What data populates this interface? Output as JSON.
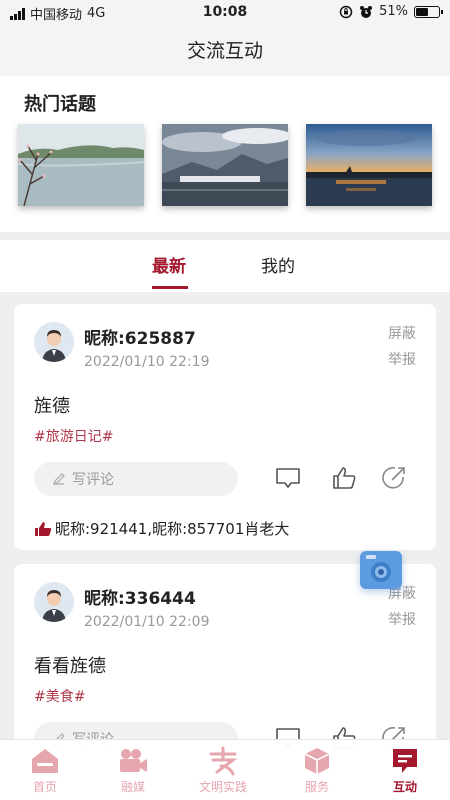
{
  "status": {
    "carrier": "中国移动",
    "network": "4G",
    "time": "10:08",
    "battery": "51%",
    "battery_level": 0.51
  },
  "header": {
    "title": "交流互动"
  },
  "hot": {
    "title": "热门话题",
    "images": [
      {
        "icon": "lake-photo"
      },
      {
        "icon": "mountain-town-photo"
      },
      {
        "icon": "sunset-lake-photo"
      }
    ]
  },
  "tabs": [
    {
      "label": "最新",
      "active": true
    },
    {
      "label": "我的",
      "active": false
    }
  ],
  "posts": [
    {
      "nickname": "昵称:625887",
      "time": "2022/01/10 22:19",
      "block": "屏蔽",
      "report": "举报",
      "content": "旌德",
      "tag": "#旅游日记#",
      "comment_placeholder": "写评论",
      "likes": "昵称:921441,昵称:857701肖老大"
    },
    {
      "nickname": "昵称:336444",
      "time": "2022/01/10 22:09",
      "block": "屏蔽",
      "report": "举报",
      "content": "看看旌德",
      "tag": "#美食#",
      "comment_placeholder": "写评论"
    }
  ],
  "nav": [
    {
      "label": "首页",
      "icon": "home-icon"
    },
    {
      "label": "融媒",
      "icon": "media-camera-icon"
    },
    {
      "label": "文明实践",
      "icon": "civilization-icon"
    },
    {
      "label": "服务",
      "icon": "service-cube-icon"
    },
    {
      "label": "互动",
      "icon": "interact-chat-icon",
      "active": true
    }
  ],
  "colors": {
    "accent": "#a3182d",
    "tag": "#b0364a",
    "nav_inactive": "#e6a6ad",
    "float_button": "#5c9be0"
  }
}
